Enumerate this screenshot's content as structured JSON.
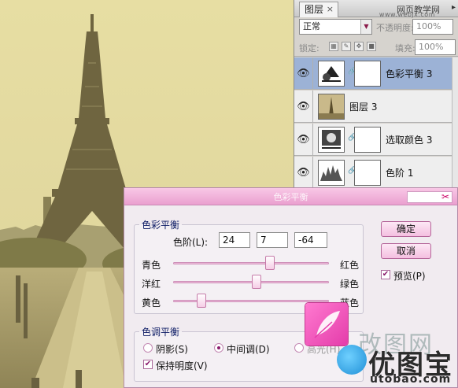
{
  "layers_panel": {
    "tab_label": "图层",
    "tab_close": "×",
    "site_text": "网页教学网",
    "site_url": "www.webjx.com",
    "blend_mode": "正常",
    "opacity_label": "不透明度:",
    "opacity_value": "100%",
    "lock_label": "锁定:",
    "fill_label": "填充:",
    "fill_value": "100%",
    "layers": [
      {
        "name": "色彩平衡 3",
        "selected": true,
        "icon": "color-balance-adjustment-icon"
      },
      {
        "name": "图层 3",
        "selected": false,
        "icon": "photo-thumbnail-icon"
      },
      {
        "name": "选取颜色 3",
        "selected": false,
        "icon": "selective-color-adjustment-icon"
      },
      {
        "name": "色阶 1",
        "selected": false,
        "icon": "levels-adjustment-icon"
      }
    ]
  },
  "dialog": {
    "title": "色彩平衡",
    "close_glyph": "✂",
    "color_balance_group": "色彩平衡",
    "levels_label": "色阶(L):",
    "levels": [
      "24",
      "7",
      "-64"
    ],
    "sliders": [
      {
        "left": "青色",
        "right": "红色",
        "value": 24
      },
      {
        "left": "洋红",
        "right": "绿色",
        "value": 7
      },
      {
        "left": "黄色",
        "right": "蓝色",
        "value": -64
      }
    ],
    "tone_group": "色调平衡",
    "tones": [
      {
        "label": "阴影(S)",
        "checked": false
      },
      {
        "label": "中间调(D)",
        "checked": true
      },
      {
        "label": "高光(H)",
        "checked": false
      }
    ],
    "preserve_label": "保持明度(V)",
    "preserve_checked": true,
    "ok_label": "确定",
    "cancel_label": "取消",
    "preview_label": "预览(P)",
    "preview_checked": true
  },
  "watermark": {
    "line1": "改图网",
    "brand": "优图宝",
    "url": "utobao.com"
  },
  "colors": {
    "accent_pink": "#ea9fcf",
    "selected_layer": "#9cb2d6",
    "photo_tint": "#d9cf95"
  }
}
